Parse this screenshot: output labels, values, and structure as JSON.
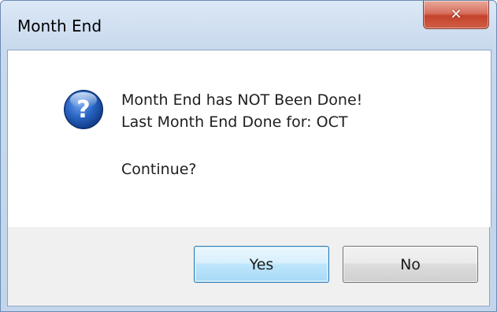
{
  "window": {
    "title": "Month End",
    "close_glyph": "✕",
    "close_icon": "close-icon"
  },
  "message": {
    "icon": "question-icon",
    "line1": "Month End has NOT Been Done!",
    "line2": "Last Month End Done for: OCT",
    "line3": "Continue?"
  },
  "buttons": {
    "yes_label": "Yes",
    "no_label": "No"
  },
  "colors": {
    "titlebar": "#c7d9ee",
    "close_button": "#c5432c",
    "default_button_border": "#3c7fb1",
    "icon_blue": "#1f5fbf"
  }
}
